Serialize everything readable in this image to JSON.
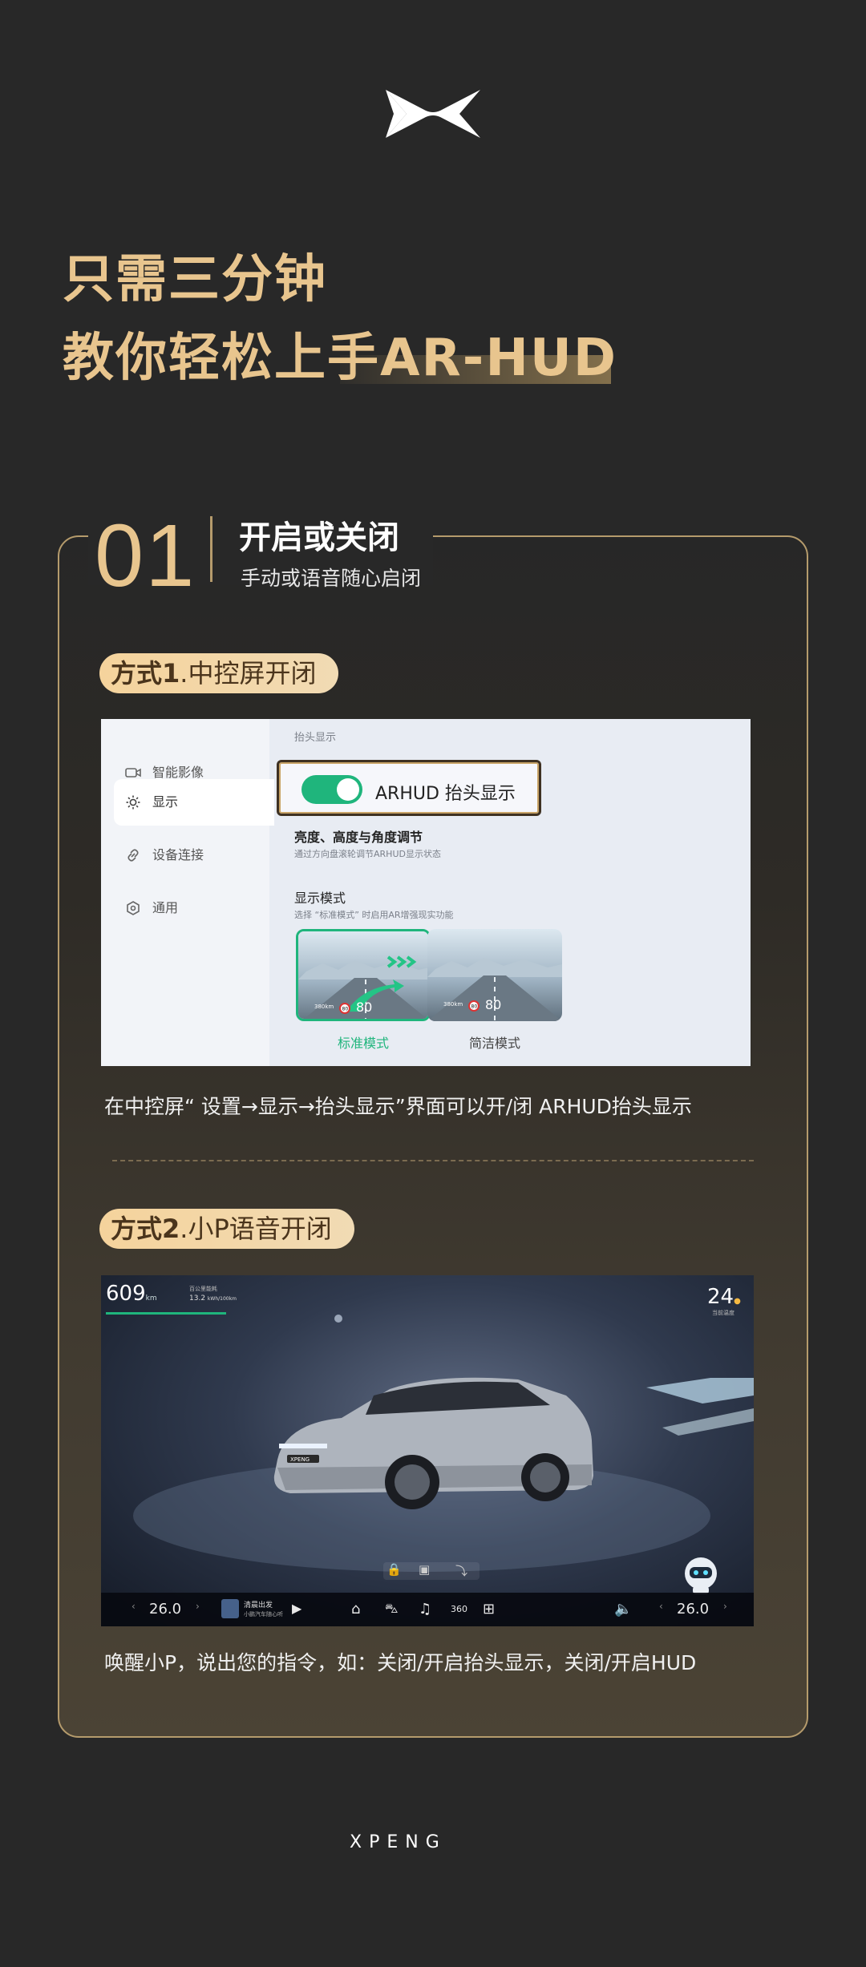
{
  "brand": {
    "logo_icon": "xpeng-x-logo-icon",
    "wordmark": "XPENG"
  },
  "headline": {
    "line1": "只需三分钟",
    "line2": "教你轻松上手AR-HUD"
  },
  "section": {
    "number": "01",
    "title": "开启或关闭",
    "subtitle": "手动或语音随心启闭"
  },
  "method1": {
    "pill_bold": "方式1",
    "pill_text": ".中控屏开闭",
    "caption": "在中控屏“ 设置→显示→抬头显示”界面可以开/闭 ARHUD抬头显示",
    "screen": {
      "sidebar": [
        {
          "label": "智能影像",
          "icon": "camera-icon"
        },
        {
          "label": "显示",
          "icon": "brightness-icon"
        },
        {
          "label": "设备连接",
          "icon": "link-icon"
        },
        {
          "label": "通用",
          "icon": "settings-hex-icon"
        }
      ],
      "panel_header": "抬头显示",
      "toggle_label": "ARHUD 抬头显示",
      "toggle_on": true,
      "brightness_title": "亮度、高度与角度调节",
      "brightness_desc": "通过方向盘滚轮调节ARHUD显示状态",
      "mode_title": "显示模式",
      "mode_desc": "选择 “标准模式” 时启用AR增强现实功能",
      "modes": [
        {
          "label": "标准模式",
          "selected": true,
          "speed": "80",
          "limit": "80",
          "dist": "380km"
        },
        {
          "label": "简洁模式",
          "selected": false,
          "speed": "80",
          "limit": "80",
          "dist": "380km"
        }
      ]
    }
  },
  "method2": {
    "pill_bold": "方式2",
    "pill_text": ".小P语音开闭",
    "caption": "唤醒小P，说出您的指令，如：关闭/开启抬头显示，关闭/开启HUD",
    "screen": {
      "range": "609",
      "range_unit": "km",
      "energy_label": "百公里能耗",
      "energy_value": "13.2",
      "energy_unit": "kWh/100km",
      "temp": "24",
      "temp_sub": "当前温度",
      "left_temp": "26.0",
      "right_temp": "26.0",
      "media_title": "清晨出发",
      "media_sub": "小鹏汽车随心听",
      "car_plate": "XPENG"
    }
  },
  "colors": {
    "gold": "#e8c58e",
    "accent_green": "#1fb57c",
    "background": "#282828"
  }
}
